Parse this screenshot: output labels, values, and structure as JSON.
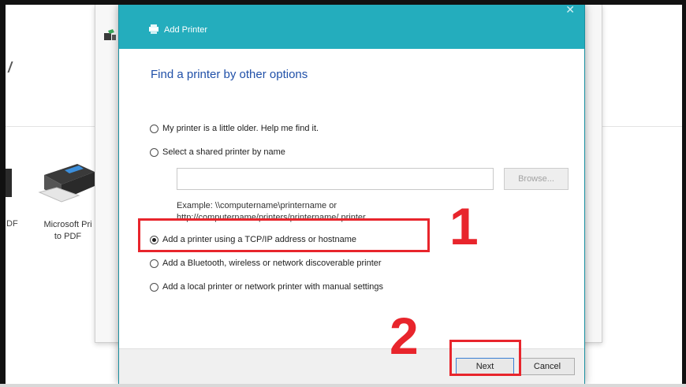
{
  "background_window": {
    "left_label": "DF",
    "printer_label_line1": "Microsoft Pri",
    "printer_label_line2": "to PDF"
  },
  "dialog": {
    "title": "Add Printer",
    "heading": "Find a printer by other options",
    "options": [
      {
        "label": "My printer is a little older. Help me find it.",
        "checked": false
      },
      {
        "label": "Select a shared printer by name",
        "checked": false
      },
      {
        "label": "Add a printer using a TCP/IP address or hostname",
        "checked": true
      },
      {
        "label": "Add a Bluetooth, wireless or network discoverable printer",
        "checked": false
      },
      {
        "label": "Add a local printer or network printer with manual settings",
        "checked": false
      }
    ],
    "shared_printer_input": {
      "value": ""
    },
    "browse_label": "Browse...",
    "example_line1": "Example: \\\\computername\\printername or",
    "example_line2": "http://computername/printers/printername/.printer",
    "next_label": "Next",
    "cancel_label": "Cancel"
  },
  "annotations": {
    "step1": "1",
    "step2": "2"
  },
  "colors": {
    "titlebar": "#24adbd",
    "heading": "#2050a8",
    "highlight": "#e8252c"
  },
  "icons": [
    "printer-icon",
    "add-printer-icon",
    "close-icon"
  ]
}
